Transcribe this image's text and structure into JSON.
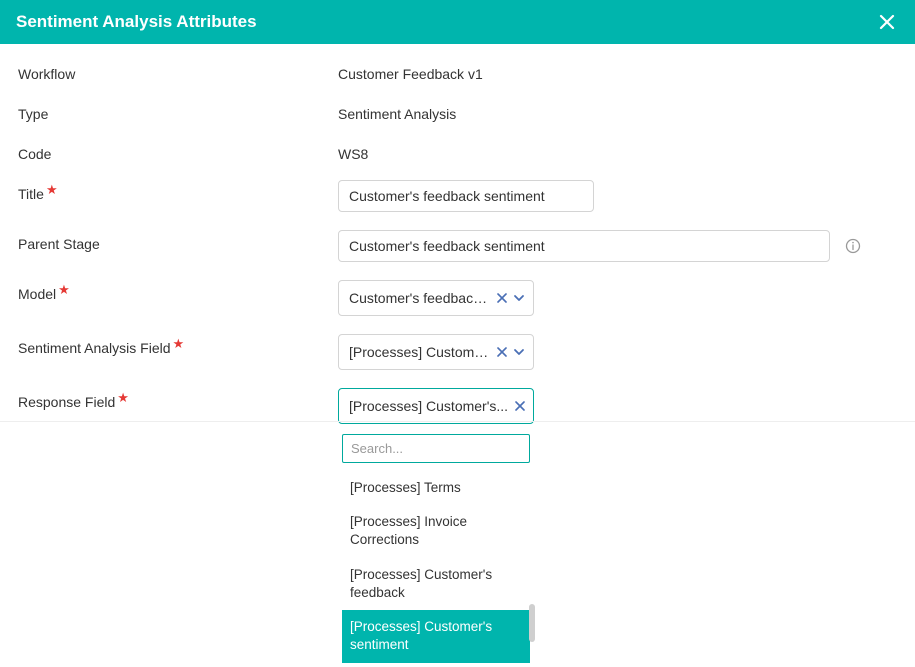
{
  "header": {
    "title": "Sentiment Analysis Attributes"
  },
  "labels": {
    "workflow": "Workflow",
    "type": "Type",
    "code": "Code",
    "title": "Title",
    "parent_stage": "Parent Stage",
    "model": "Model",
    "sa_field": "Sentiment Analysis Field",
    "response_field": "Response Field"
  },
  "values": {
    "workflow": "Customer Feedback v1",
    "type": "Sentiment Analysis",
    "code": "WS8",
    "title": "Customer's feedback sentiment",
    "parent_stage": "Customer's feedback sentiment",
    "model": "Customer's feedback s...",
    "sa_field": "[Processes] Customer's...",
    "response_field": "[Processes] Customer's..."
  },
  "dropdown": {
    "search_placeholder": "Search...",
    "options": [
      "[Processes] Terms",
      "[Processes] Invoice Corrections",
      "[Processes] Customer's feedback",
      "[Processes] Customer's sentiment"
    ],
    "selected_index": 3
  },
  "glyphs": {
    "required": "★"
  }
}
